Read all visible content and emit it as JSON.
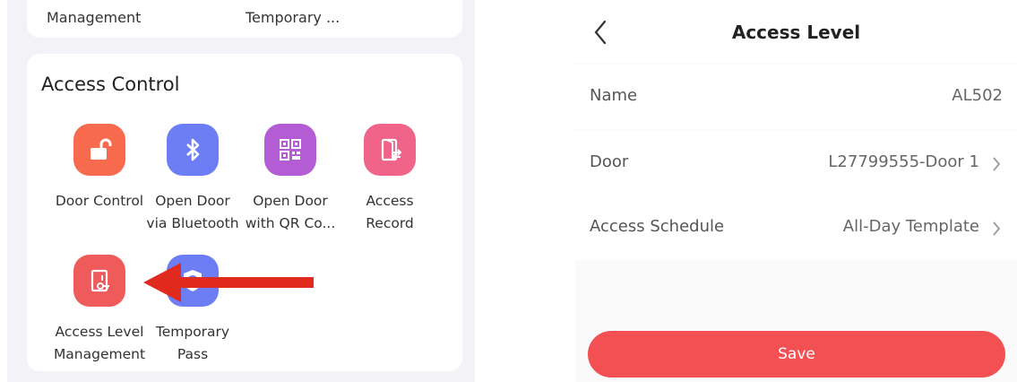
{
  "left_panel": {
    "top_card": {
      "item1_label": "Management",
      "item2_label": "Temporary ..."
    },
    "access_control": {
      "title": "Access Control",
      "tiles": [
        {
          "icon": "unlock-icon",
          "color": "#f76a4e",
          "line1": "Door Control",
          "line2": ""
        },
        {
          "icon": "bluetooth-icon",
          "color": "#6d7ef5",
          "line1": "Open Door",
          "line2": "via Bluetooth"
        },
        {
          "icon": "qr-code-icon",
          "color": "#b35cd4",
          "line1": "Open Door",
          "line2": "with QR Co..."
        },
        {
          "icon": "access-record-icon",
          "color": "#f0648a",
          "line1": "Access",
          "line2": "Record"
        },
        {
          "icon": "access-level-icon",
          "color": "#ef5a5a",
          "line1": "Access Level",
          "line2": "Management"
        },
        {
          "icon": "temporary-pass-icon",
          "color": "#6d7ef5",
          "line1": "Temporary",
          "line2": "Pass"
        }
      ]
    },
    "annotation_arrow_color": "#e02a1e"
  },
  "right_panel": {
    "nav": {
      "title": "Access Level"
    },
    "rows": [
      {
        "label": "Name",
        "value": "AL502"
      },
      {
        "label": "Door",
        "value": "L27799555-Door 1"
      },
      {
        "label": "Access Schedule",
        "value": "All-Day Template"
      }
    ],
    "save_label": "Save",
    "accent": "#f25052"
  }
}
